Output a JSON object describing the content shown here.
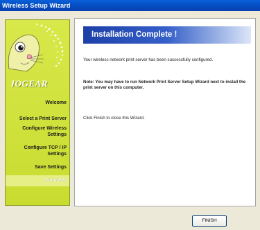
{
  "window": {
    "title": "Wireless Setup Wizard"
  },
  "sidebar": {
    "brand": "IOGEAR",
    "steps": [
      {
        "label": "Welcome"
      },
      {
        "label": "Select a Print Server"
      },
      {
        "label": "Configure Wireless Settings"
      },
      {
        "label": "Configure TCP / IP Settings"
      },
      {
        "label": "Save Settings"
      },
      {
        "label": "Complete",
        "current": true
      }
    ]
  },
  "main": {
    "heading": "Installation Complete !",
    "message": "Your wireless network print server has been successfully configured.",
    "note": "Note: You may have to run Network Print Server Setup Wizard next to install the print server on this computer.",
    "instruction": "Click Finish to close this Wizard."
  },
  "footer": {
    "finish_label": "FINISH"
  },
  "colors": {
    "titlebar": "#0551c8",
    "sidebar": "#c8dc30",
    "header_start": "#1e3fa8",
    "header_end": "#dce6f8"
  }
}
